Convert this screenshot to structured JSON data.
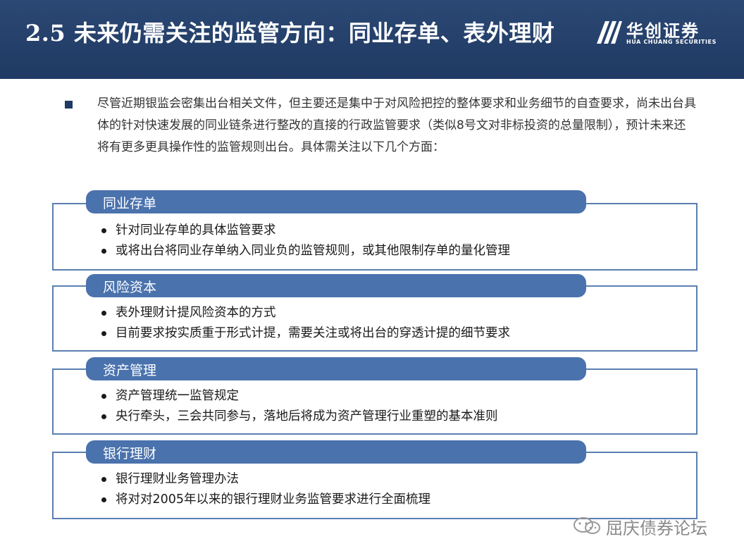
{
  "header": {
    "title_num": "2.5",
    "title_text": "未来仍需关注的监管方向：同业存单、表外理财",
    "logo_cn": "华创证券",
    "logo_en": "HUA CHUANG SECURITIES",
    "bg_color": "#1f3a63"
  },
  "intro": {
    "text": "尽管近期银监会密集出台相关文件，但主要还是集中于对风险把控的整体要求和业务细节的自查要求，尚未出台具体的针对快速发展的同业链条进行整改的直接的行政监管要求（类似8号文对非标投资的总量限制），预计未来还将有更多更具操作性的监管规则出台。具体需关注以下几个方面："
  },
  "sections": [
    {
      "title": "同业存单",
      "items": [
        "针对同业存单的具体监管要求",
        "或将出台将同业存单纳入同业负的监管规则，或其他限制存单的量化管理"
      ]
    },
    {
      "title": "风险资本",
      "items": [
        "表外理财计提风险资本的方式",
        "目前要求按实质重于形式计提，需要关注或将出台的穿透计提的细节要求"
      ]
    },
    {
      "title": "资产管理",
      "items": [
        "资产管理统一监管规定",
        "央行牵头，三会共同参与，落地后将成为资产管理行业重塑的基本准则"
      ]
    },
    {
      "title": "银行理财",
      "items": [
        "银行理财业务管理办法",
        "将对对2005年以来的银行理财业务监管要求进行全面梳理"
      ]
    }
  ],
  "watermark": {
    "text": "屈庆债券论坛",
    "icon": "wechat-icon"
  },
  "colors": {
    "accent": "#4a72ad",
    "border": "#5b7fb1"
  }
}
